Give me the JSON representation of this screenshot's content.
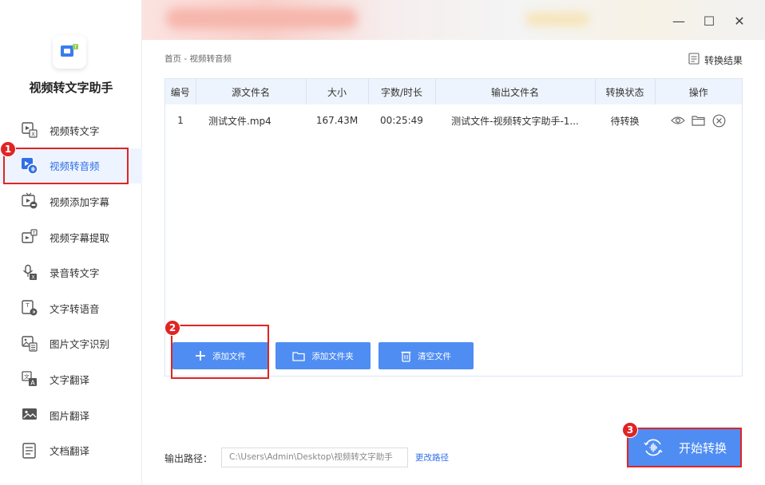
{
  "app": {
    "title": "视频转文字助手"
  },
  "sidebar": {
    "items": [
      {
        "label": "视频转文字",
        "icon": "video-to-text-icon",
        "active": false
      },
      {
        "label": "视频转音频",
        "icon": "video-to-audio-icon",
        "active": true
      },
      {
        "label": "视频添加字幕",
        "icon": "add-subtitle-icon",
        "active": false
      },
      {
        "label": "视频字幕提取",
        "icon": "subtitle-extract-icon",
        "active": false
      },
      {
        "label": "录音转文字",
        "icon": "recording-to-text-icon",
        "active": false
      },
      {
        "label": "文字转语音",
        "icon": "text-to-speech-icon",
        "active": false
      },
      {
        "label": "图片文字识别",
        "icon": "image-ocr-icon",
        "active": false
      },
      {
        "label": "文字翻译",
        "icon": "text-translate-icon",
        "active": false
      },
      {
        "label": "图片翻译",
        "icon": "image-translate-icon",
        "active": false
      },
      {
        "label": "文档翻译",
        "icon": "document-translate-icon",
        "active": false
      }
    ]
  },
  "window_controls": {
    "minimize": "—",
    "maximize": "☐",
    "close": "✕"
  },
  "breadcrumb": "首页 - 视频转音频",
  "result_link": "转换结果",
  "table": {
    "headers": [
      "编号",
      "源文件名",
      "大小",
      "字数/时长",
      "输出文件名",
      "转换状态",
      "操作"
    ],
    "rows": [
      {
        "num": "1",
        "source": "测试文件.mp4",
        "size": "167.43M",
        "duration": "00:25:49",
        "output": "测试文件-视频转文字助手-1...",
        "status": "待转换"
      }
    ]
  },
  "buttons": {
    "add_file": "添加文件",
    "add_folder": "添加文件夹",
    "clear_files": "清空文件",
    "start": "开始转换"
  },
  "output": {
    "label": "输出路径：",
    "path": "C:\\Users\\Admin\\Desktop\\视频转文字助手",
    "change": "更改路径"
  },
  "annotations": [
    "1",
    "2",
    "3"
  ],
  "colors": {
    "accent": "#4f8df3",
    "annotation": "#e02424",
    "active_bg": "#eef4ff"
  }
}
